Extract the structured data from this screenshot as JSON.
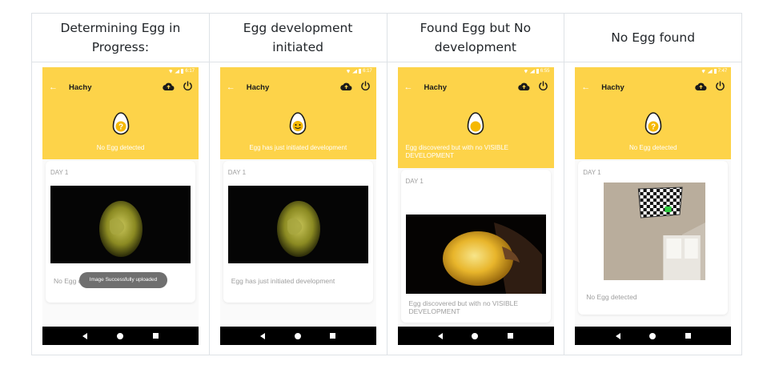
{
  "columns": [
    {
      "heading": "Determining Egg in Progress:",
      "time": "6:17",
      "app_title": "Hachy",
      "egg_state": "unknown",
      "status_text": "No Egg detected",
      "day_label": "DAY 1",
      "caption": "No Egg detected",
      "toast": "Image Successfully uploaded"
    },
    {
      "heading": "Egg development initiated",
      "time": "6:17",
      "app_title": "Hachy",
      "egg_state": "developing",
      "status_text": "Egg has just initiated development",
      "day_label": "DAY 1",
      "caption": "Egg has just initiated development"
    },
    {
      "heading": "Found Egg but No development",
      "time": "6:55",
      "app_title": "Hachy",
      "egg_state": "found",
      "status_text": "Egg discovered but with no VISIBLE DEVELOPMENT",
      "day_label": "DAY 1",
      "caption": "Egg discovered but with no VISIBLE DEVELOPMENT"
    },
    {
      "heading": "No Egg found",
      "time": "7:47",
      "app_title": "Hachy",
      "egg_state": "unknown",
      "status_text": "No Egg detected",
      "day_label": "DAY 1",
      "caption": "No Egg detected"
    }
  ],
  "icons": {
    "back": "arrow-left-icon",
    "upload": "cloud-upload-icon",
    "power": "power-icon",
    "nav_back": "nav-back-icon",
    "nav_home": "nav-home-icon",
    "nav_recent": "nav-recent-icon"
  },
  "colors": {
    "header_yellow": "#fdd349",
    "egg_yolk": "#f5b800",
    "border": "#dee2e6"
  }
}
